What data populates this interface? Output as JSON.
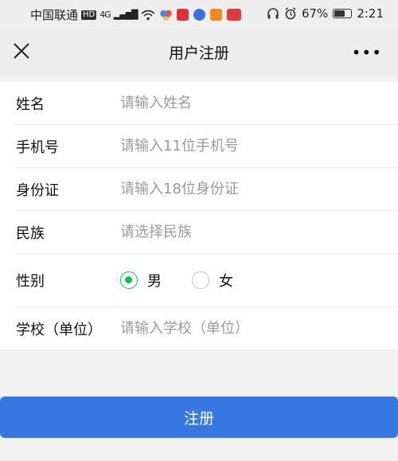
{
  "statusbar": {
    "carrier": "中国联通",
    "hd": "HD",
    "network": "4G",
    "battery_percent": "67%",
    "battery_level": 0.67,
    "time": "2:21",
    "icons": [
      "wifi-icon",
      "headphones-icon",
      "alarm-icon",
      "battery-icon"
    ]
  },
  "navbar": {
    "title": "用户注册",
    "close_icon": "close-icon",
    "more_label": "•••"
  },
  "form": {
    "name": {
      "label": "姓名",
      "placeholder": "请输入姓名"
    },
    "phone": {
      "label": "手机号",
      "placeholder": "请输入11位手机号"
    },
    "idcard": {
      "label": "身份证",
      "placeholder": "请输入18位身份证"
    },
    "ethnicity": {
      "label": "民族",
      "placeholder": "请选择民族"
    },
    "gender": {
      "label": "性别",
      "options": [
        {
          "label": "男",
          "checked": true
        },
        {
          "label": "女",
          "checked": false
        }
      ]
    },
    "school": {
      "label": "学校（单位）",
      "placeholder": "请输入学校（单位）"
    }
  },
  "submit_label": "注册",
  "colors": {
    "accent_green": "#07c160",
    "button_blue": "#3777e2"
  }
}
